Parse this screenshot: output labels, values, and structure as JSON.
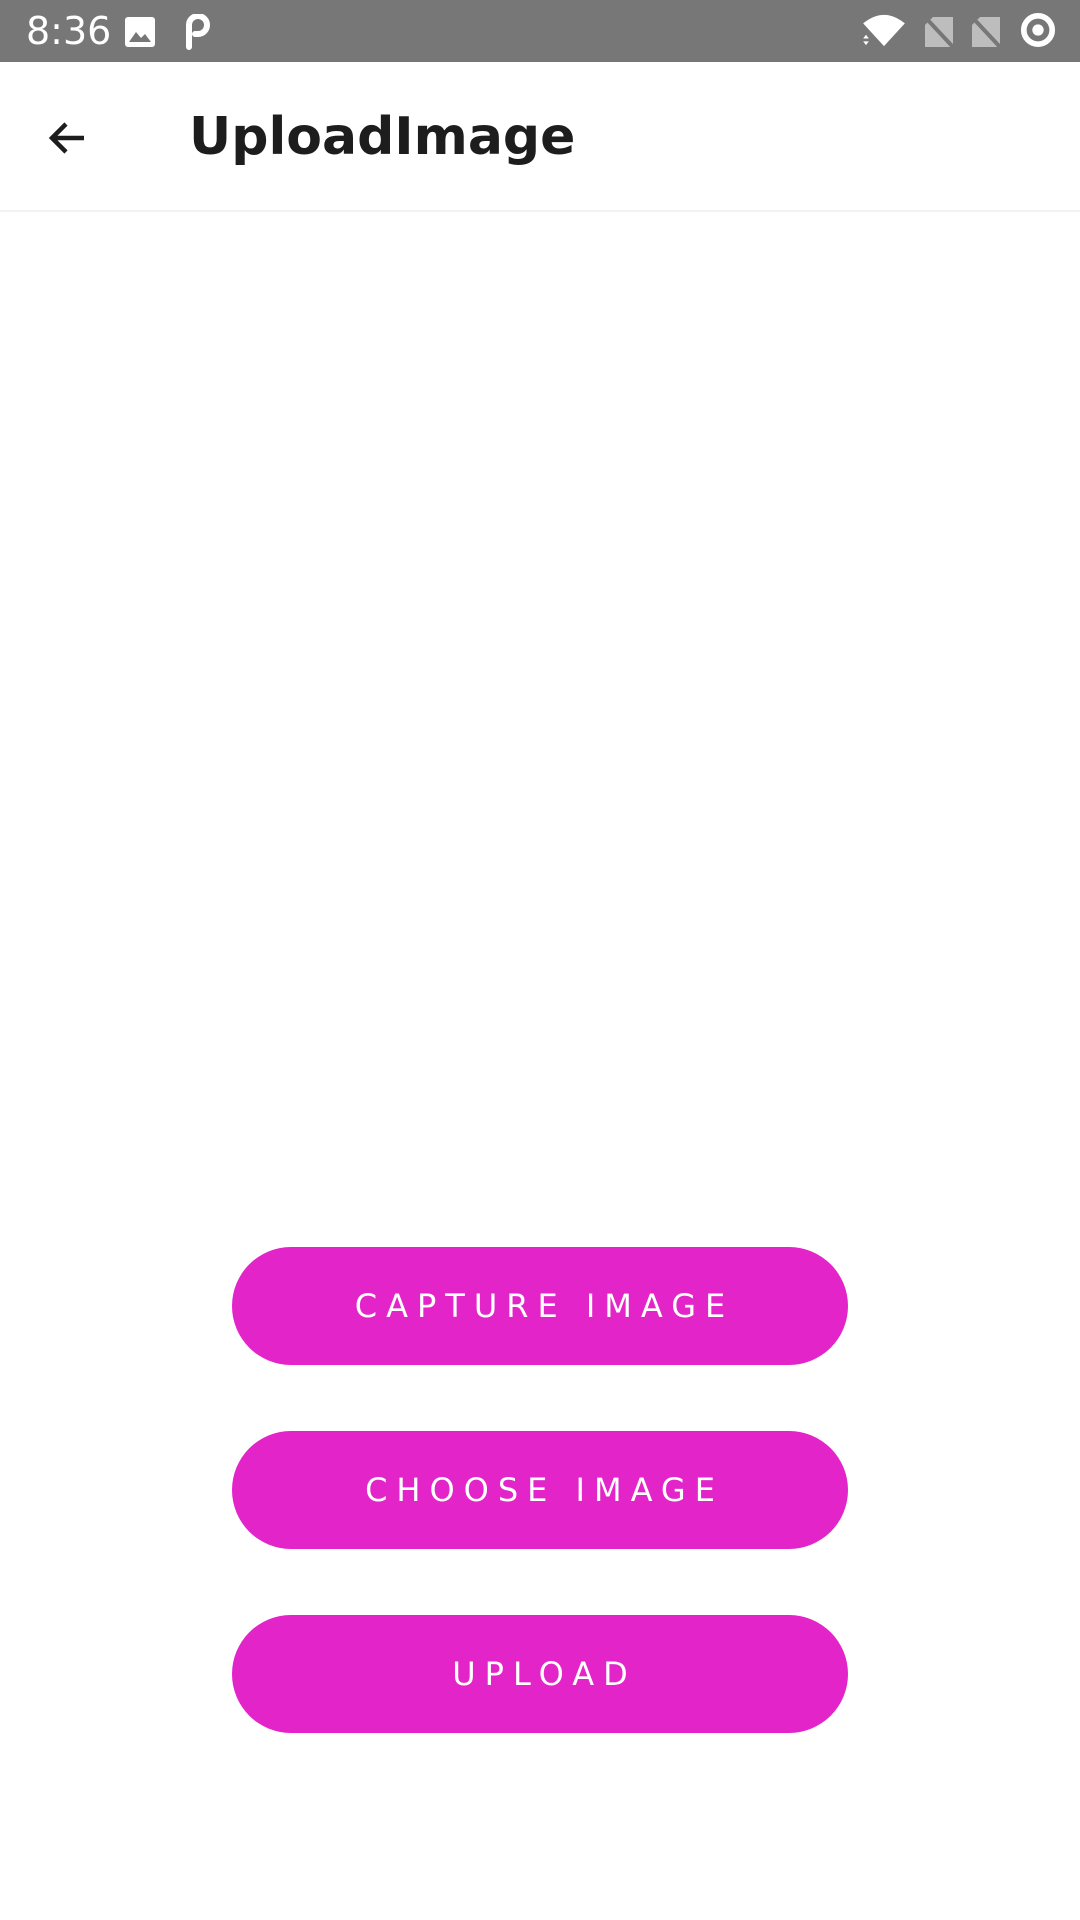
{
  "status_bar": {
    "time": "8:36",
    "background_color": "#777777",
    "left_icons": [
      "image-notification-icon",
      "parking-app-icon"
    ],
    "right_icons": [
      "wifi-icon",
      "sim-no-signal-icon",
      "sim-no-signal-icon",
      "circle-status-icon"
    ]
  },
  "app_bar": {
    "back_icon": "arrow-left-icon",
    "title": "UploadImage"
  },
  "actions": {
    "capture_label": "CAPTURE IMAGE",
    "choose_label": "CHOOSE IMAGE",
    "upload_label": "UPLOAD"
  },
  "colors": {
    "accent": "#e324c9",
    "button_text": "#ffffff",
    "title_text": "#1d1d1d"
  }
}
